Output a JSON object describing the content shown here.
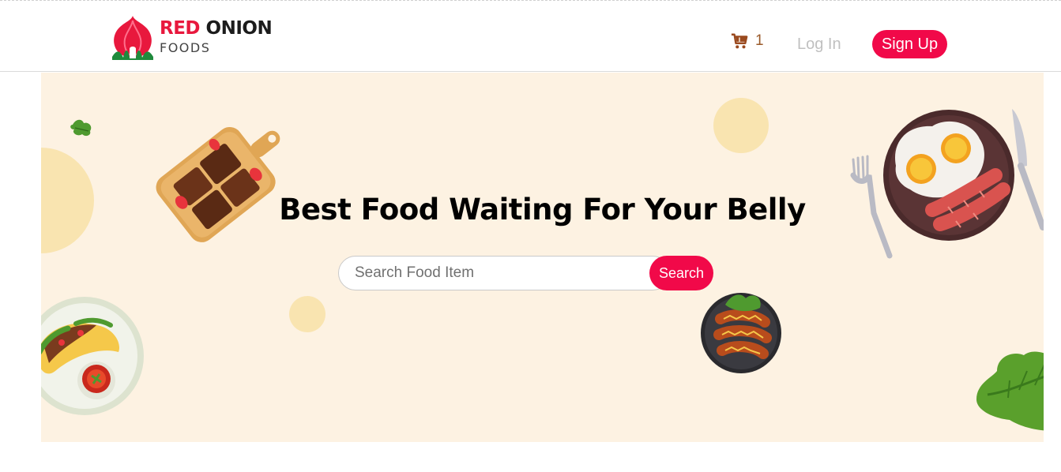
{
  "brand": {
    "name_part1": "RED",
    "name_part2": "ONION",
    "tagline": "FOODS",
    "primary_color": "#f10949",
    "hero_bg": "#fdf2e2"
  },
  "nav": {
    "cart_icon": "shopping-cart-icon",
    "cart_count": "1",
    "login_label": "Log In",
    "signup_label": "Sign Up"
  },
  "hero": {
    "title": "Best Food Waiting For Your Belly",
    "search_placeholder": "Search Food Item",
    "search_value": "",
    "search_button_label": "Search"
  },
  "illustrations": [
    "leaf-icon",
    "chocolate-board-icon",
    "breakfast-plate-icon",
    "taco-plate-icon",
    "sausage-pan-icon",
    "lettuce-icon"
  ]
}
